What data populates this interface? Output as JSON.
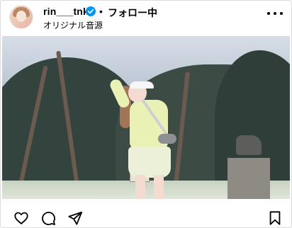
{
  "header": {
    "username": "rin___tnk",
    "separator": "•",
    "follow_label": "フォロー中",
    "subtitle": "オリジナル音源"
  },
  "media": {
    "sign_text": "",
    "muted": true
  },
  "icons": {
    "verified": "verified-badge-icon",
    "more": "more-options-icon",
    "mute": "speaker-muted-icon",
    "like": "heart-icon",
    "comment": "comment-bubble-icon",
    "share": "paper-plane-icon",
    "save": "bookmark-icon"
  },
  "colors": {
    "verified_blue": "#0095f6",
    "text": "#000000",
    "border": "#dbdbdb"
  }
}
